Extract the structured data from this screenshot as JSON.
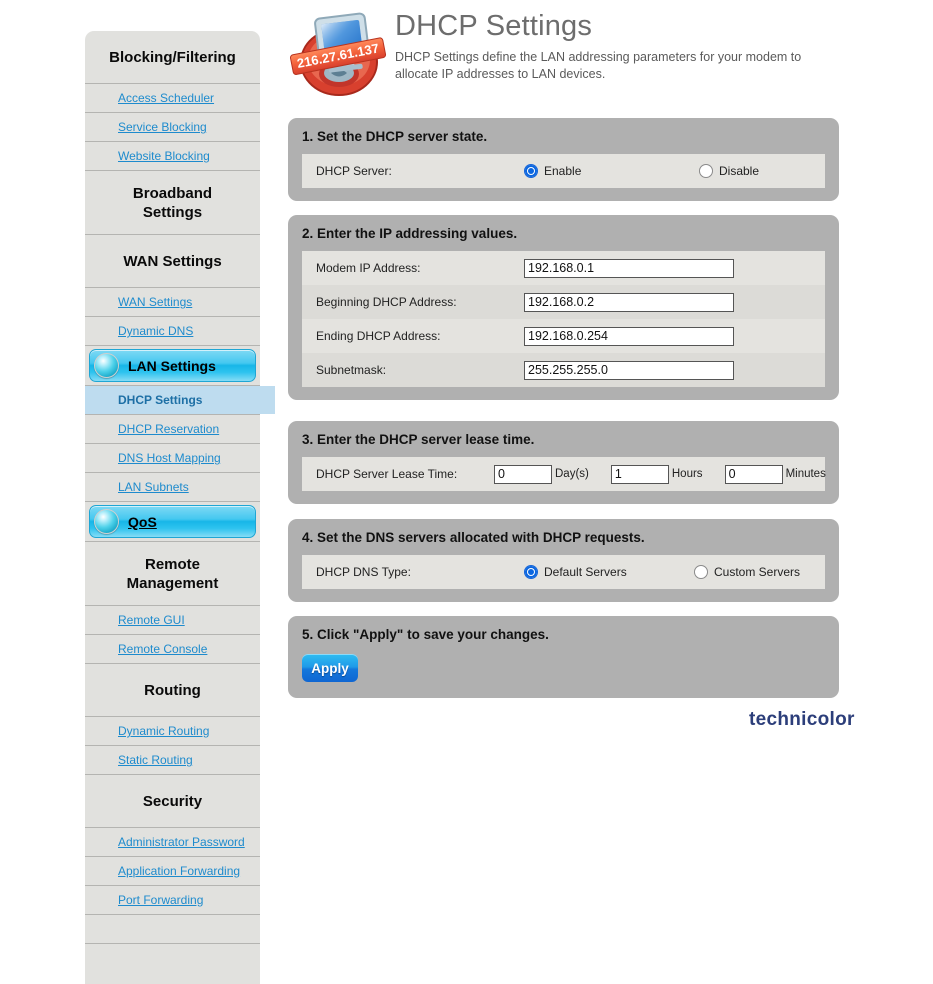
{
  "sidebar": {
    "groups": [
      {
        "title": "Blocking/Filtering",
        "links": [
          "Access Scheduler",
          "Service Blocking",
          "Website Blocking"
        ]
      },
      {
        "title": "Broadband Settings",
        "links": []
      },
      {
        "title": "WAN Settings",
        "links": [
          "WAN Settings",
          "Dynamic DNS"
        ]
      },
      {
        "title": "Remote Management",
        "links": [
          "Remote GUI",
          "Remote Console"
        ]
      },
      {
        "title": "Routing",
        "links": [
          "Dynamic Routing",
          "Static Routing"
        ]
      },
      {
        "title": "Security",
        "links": [
          "Administrator Password",
          "Application Forwarding",
          "Port Forwarding"
        ]
      }
    ],
    "lan_bar_label": "LAN Settings",
    "lan_selected_item": "DHCP Settings",
    "lan_links": [
      "DHCP Reservation",
      "DNS Host Mapping",
      "LAN Subnets"
    ],
    "qos_bar_label": "QoS"
  },
  "header": {
    "title": "DHCP Settings",
    "description": "DHCP Settings define the LAN addressing parameters for your modem to allocate IP addresses to LAN devices.",
    "icon_ip_banner": "216.27.61.137"
  },
  "section1": {
    "title": "1. Set the DHCP server state.",
    "label": "DHCP Server:",
    "option_enable": "Enable",
    "option_disable": "Disable",
    "selected": "Enable"
  },
  "section2": {
    "title": "2. Enter the IP addressing values.",
    "fields": [
      {
        "label": "Modem IP Address:",
        "value": "192.168.0.1"
      },
      {
        "label": "Beginning DHCP Address:",
        "value": "192.168.0.2"
      },
      {
        "label": "Ending DHCP Address:",
        "value": "192.168.0.254"
      },
      {
        "label": "Subnetmask:",
        "value": "255.255.255.0"
      }
    ]
  },
  "section3": {
    "title": "3. Enter the DHCP server lease time.",
    "label": "DHCP Server Lease Time:",
    "days_value": "0",
    "days_unit": "Day(s)",
    "hours_value": "1",
    "hours_unit": "Hours",
    "minutes_value": "0",
    "minutes_unit": "Minutes"
  },
  "section4": {
    "title": "4. Set the DNS servers allocated with DHCP requests.",
    "label": "DHCP DNS Type:",
    "option_default": "Default Servers",
    "option_custom": "Custom Servers",
    "selected": "Default Servers"
  },
  "section5": {
    "title": "5. Click \"Apply\" to save your changes.",
    "apply_label": "Apply"
  },
  "brand": "technicolor",
  "colors": {
    "accent_cyan": "#17b6e8",
    "link_blue": "#1e8bcd",
    "panel_gray": "#b0b0b0",
    "apply_blue": "#1478dc",
    "brand_navy": "#2c3e7a"
  }
}
